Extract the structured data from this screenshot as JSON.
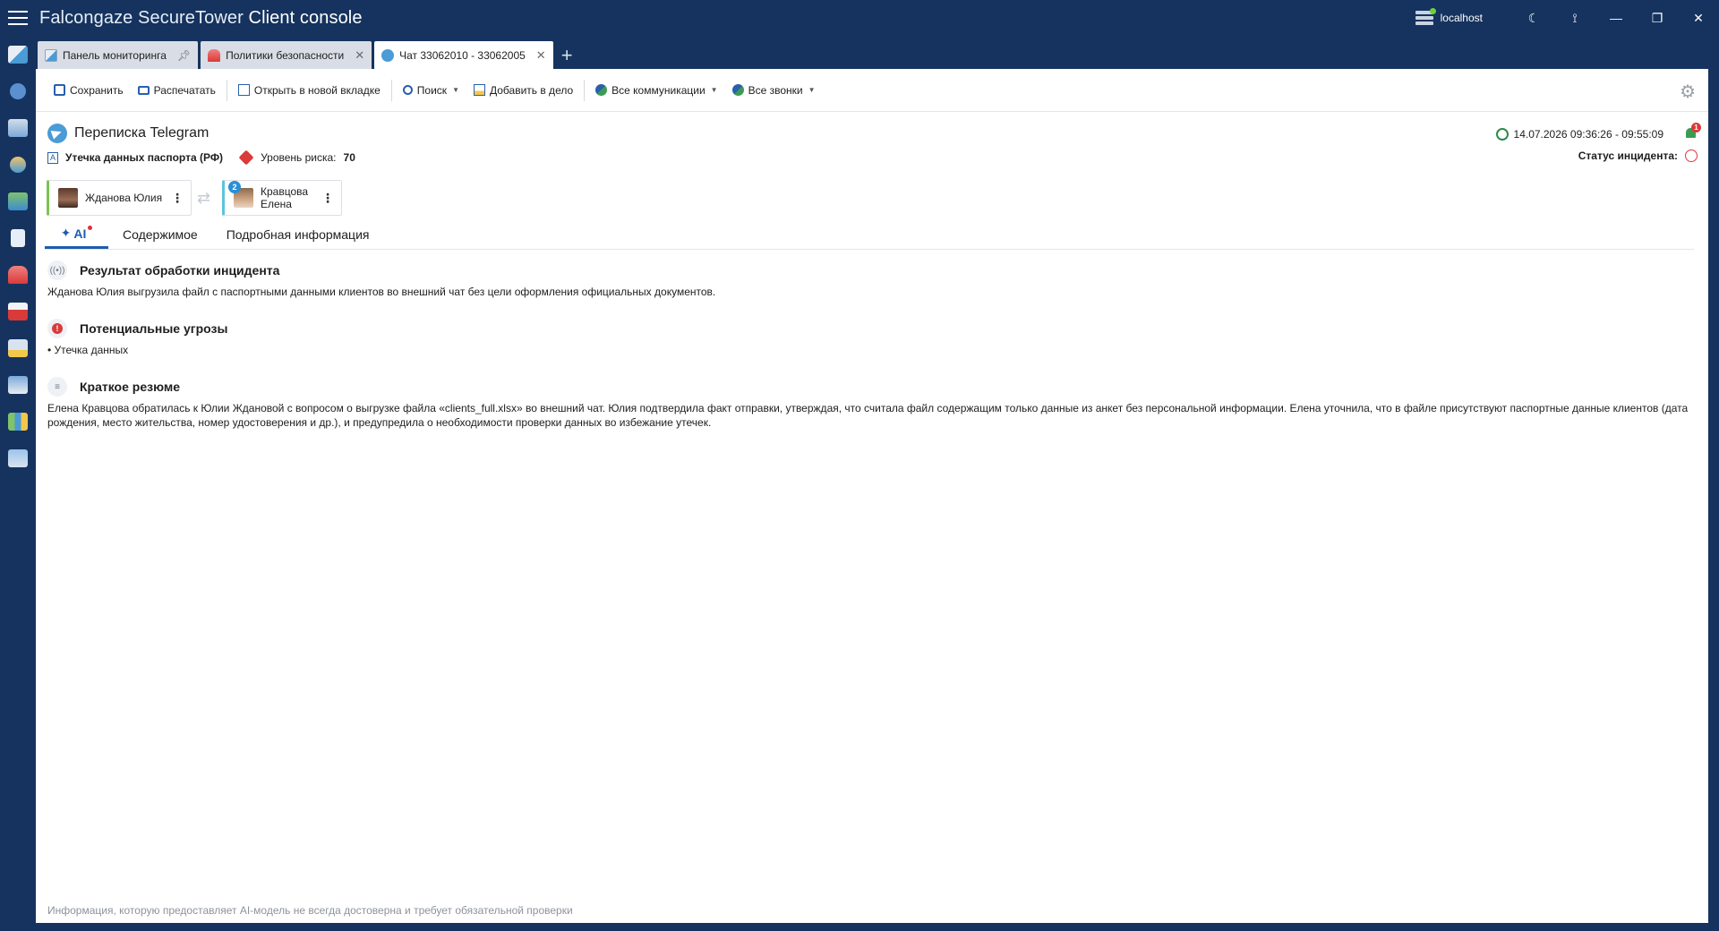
{
  "app": {
    "brand_light": "Falcongaze SecureTower",
    "brand_bold": "Client console",
    "server": "localhost"
  },
  "window_controls": {
    "theme_icon": "moon-icon",
    "feedback_icon": "feedback-icon",
    "minimize": "—",
    "maximize": "❐",
    "close": "✕"
  },
  "tabs": [
    {
      "label": "Панель мониторинга",
      "icon": "dashboard-icon",
      "pinned": true
    },
    {
      "label": "Политики безопасности",
      "icon": "alarm-icon",
      "closable": true
    },
    {
      "label": "Чат 33062010 - 33062005",
      "icon": "telegram-icon",
      "closable": true,
      "active": true
    }
  ],
  "toolbar": {
    "save": "Сохранить",
    "print": "Распечатать",
    "open_new_tab": "Открыть в новой вкладке",
    "search": "Поиск",
    "add_to_case": "Добавить в дело",
    "all_communications": "Все коммуникации",
    "all_calls": "Все звонки"
  },
  "incident": {
    "title": "Переписка Telegram",
    "policy": "Утечка данных паспорта (РФ)",
    "risk_label": "Уровень риска:",
    "risk_value": "70",
    "datetime": "14.07.2026 09:36:26 - 09:55:09",
    "status_label": "Статус инцидента:",
    "notifications": "1"
  },
  "participants": {
    "sender": "Жданова Юлия",
    "recipient": "Кравцова Елена",
    "recipient_badge": "2"
  },
  "content_tabs": {
    "ai": "AI",
    "content": "Содержимое",
    "details": "Подробная информация"
  },
  "sections": {
    "result_title": "Результат обработки инцидента",
    "result_text": "Жданова Юлия выгрузила файл с паспортными данными клиентов во внешний чат без цели оформления официальных документов.",
    "threats_title": "Потенциальные угрозы",
    "threats_text": "• Утечка данных",
    "summary_title": "Краткое резюме",
    "summary_text": "Елена Кравцова обратилась к Юлии Ждановой с вопросом о выгрузке файла «clients_full.xlsx» во внешний чат. Юлия подтвердила факт отправки, утверждая, что считала файл содержащим только данные из анкет без персональной информации. Елена уточнила, что в файле присутствуют паспортные данные клиентов (дата рождения, место жительства, номер удостоверения и др.), и предупредила о необходимости проверки данных во избежание утечек."
  },
  "footer": "Информация, которую предоставляет AI-модель не всегда достоверна и требует обязательной проверки",
  "colors": {
    "chrome": "#15335e",
    "accent": "#1f5cae",
    "risk": "#d93a3a",
    "sender_stripe": "#7cc352",
    "recipient_stripe": "#5ec3de"
  }
}
